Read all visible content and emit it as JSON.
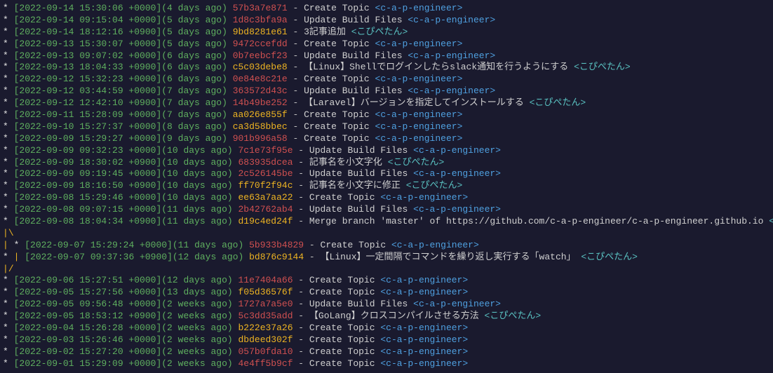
{
  "lines": [
    {
      "graph": "* ",
      "date": "[2022-09-14 15:30:06 +0000]",
      "ago": "(4 days ago)",
      "hash": "57b3a7e871",
      "hashColor": "red",
      "msg": "Create Topic",
      "author": "<c-a-p-engineer>",
      "authorClass": "author-cap"
    },
    {
      "graph": "* ",
      "date": "[2022-09-14 09:15:04 +0000]",
      "ago": "(5 days ago)",
      "hash": "1d8c3bfa9a",
      "hashColor": "red",
      "msg": "Update Build Files",
      "author": "<c-a-p-engineer>",
      "authorClass": "author-cap"
    },
    {
      "graph": "* ",
      "date": "[2022-09-14 18:12:16 +0900]",
      "ago": "(5 days ago)",
      "hash": "9bd8281e61",
      "hashColor": "",
      "msg": "3記事追加",
      "author": "<こぴぺたん>",
      "authorClass": "author-kt"
    },
    {
      "graph": "* ",
      "date": "[2022-09-13 15:30:07 +0000]",
      "ago": "(5 days ago)",
      "hash": "9472ccefdd",
      "hashColor": "red",
      "msg": "Create Topic",
      "author": "<c-a-p-engineer>",
      "authorClass": "author-cap"
    },
    {
      "graph": "* ",
      "date": "[2022-09-13 09:07:02 +0000]",
      "ago": "(6 days ago)",
      "hash": "0b7eebcf23",
      "hashColor": "red",
      "msg": "Update Build Files",
      "author": "<c-a-p-engineer>",
      "authorClass": "author-cap"
    },
    {
      "graph": "* ",
      "date": "[2022-09-13 18:04:33 +0900]",
      "ago": "(6 days ago)",
      "hash": "c5c03debe8",
      "hashColor": "",
      "msg": "【Linux】Shellでログインしたらslack通知を行うようにする",
      "author": "<こぴぺたん>",
      "authorClass": "author-kt"
    },
    {
      "graph": "* ",
      "date": "[2022-09-12 15:32:23 +0000]",
      "ago": "(6 days ago)",
      "hash": "0e84e8c21e",
      "hashColor": "red",
      "msg": "Create Topic",
      "author": "<c-a-p-engineer>",
      "authorClass": "author-cap"
    },
    {
      "graph": "* ",
      "date": "[2022-09-12 03:44:59 +0000]",
      "ago": "(7 days ago)",
      "hash": "363572d43c",
      "hashColor": "red",
      "msg": "Update Build Files",
      "author": "<c-a-p-engineer>",
      "authorClass": "author-cap"
    },
    {
      "graph": "* ",
      "date": "[2022-09-12 12:42:10 +0900]",
      "ago": "(7 days ago)",
      "hash": "14b49be252",
      "hashColor": "red",
      "msg": "【Laravel】バージョンを指定してインストールする",
      "author": "<こぴぺたん>",
      "authorClass": "author-kt"
    },
    {
      "graph": "* ",
      "date": "[2022-09-11 15:28:09 +0000]",
      "ago": "(7 days ago)",
      "hash": "aa026e855f",
      "hashColor": "",
      "msg": "Create Topic",
      "author": "<c-a-p-engineer>",
      "authorClass": "author-cap"
    },
    {
      "graph": "* ",
      "date": "[2022-09-10 15:27:37 +0000]",
      "ago": "(8 days ago)",
      "hash": "ca3d58bbec",
      "hashColor": "",
      "msg": "Create Topic",
      "author": "<c-a-p-engineer>",
      "authorClass": "author-cap"
    },
    {
      "graph": "* ",
      "date": "[2022-09-09 15:29:27 +0000]",
      "ago": "(9 days ago)",
      "hash": "901b996a58",
      "hashColor": "red",
      "msg": "Create Topic",
      "author": "<c-a-p-engineer>",
      "authorClass": "author-cap"
    },
    {
      "graph": "*   ",
      "date": "[2022-09-09 09:32:23 +0000]",
      "ago": "(10 days ago)",
      "hash": "7c1e73f95e",
      "hashColor": "red",
      "msg": "Update Build Files",
      "author": "<c-a-p-engineer>",
      "authorClass": "author-cap"
    },
    {
      "graph": "*   ",
      "date": "[2022-09-09 18:30:02 +0900]",
      "ago": "(10 days ago)",
      "hash": "683935dcea",
      "hashColor": "red",
      "msg": "記事名を小文字化",
      "author": "<こぴぺたん>",
      "authorClass": "author-kt"
    },
    {
      "graph": "*   ",
      "date": "[2022-09-09 09:19:45 +0000]",
      "ago": "(10 days ago)",
      "hash": "2c526145be",
      "hashColor": "red",
      "msg": "Update Build Files",
      "author": "<c-a-p-engineer>",
      "authorClass": "author-cap"
    },
    {
      "graph": "*   ",
      "date": "[2022-09-09 18:16:50 +0900]",
      "ago": "(10 days ago)",
      "hash": "ff70f2f94c",
      "hashColor": "",
      "msg": "記事名を小文字に修正",
      "author": "<こぴぺたん>",
      "authorClass": "author-kt"
    },
    {
      "graph": "*   ",
      "date": "[2022-09-08 15:29:46 +0000]",
      "ago": "(10 days ago)",
      "hash": "ee63a7aa22",
      "hashColor": "",
      "msg": "Create Topic",
      "author": "<c-a-p-engineer>",
      "authorClass": "author-cap"
    },
    {
      "graph": "*   ",
      "date": "[2022-09-08 09:07:15 +0000]",
      "ago": "(11 days ago)",
      "hash": "2b42762ab4",
      "hashColor": "red",
      "msg": "Update Build Files",
      "author": "<c-a-p-engineer>",
      "authorClass": "author-cap"
    },
    {
      "graph": "*   ",
      "date": "[2022-09-08 18:04:34 +0900]",
      "ago": "(11 days ago)",
      "hash": "d19c4ed24f",
      "hashColor": "",
      "msg": "Merge branch 'master' of https://github.com/c-a-p-engineer/c-a-p-engineer.github.io",
      "author": "<こぴぺたん>",
      "authorClass": "author-kt",
      "isMerge": true
    },
    {
      "graph": "|\\",
      "branchLine": true
    },
    {
      "graph": "| * ",
      "date": "[2022-09-07 15:29:24 +0000]",
      "ago": "(11 days ago)",
      "hash": "5b933b4829",
      "hashColor": "red",
      "msg": "Create Topic",
      "author": "<c-a-p-engineer>",
      "authorClass": "author-cap"
    },
    {
      "graph": "* | ",
      "date": "[2022-09-07 09:37:36 +0900]",
      "ago": "(12 days ago)",
      "hash": "bd876c9144",
      "hashColor": "",
      "msg": "【Linux】一定間隔でコマンドを繰り返し実行する「watch」",
      "author": "<こぴぺたん>",
      "authorClass": "author-kt"
    },
    {
      "graph": "|/",
      "branchLine": true
    },
    {
      "graph": "* ",
      "date": "[2022-09-06 15:27:51 +0000]",
      "ago": "(12 days ago)",
      "hash": "11e7404a66",
      "hashColor": "red",
      "msg": "Create Topic",
      "author": "<c-a-p-engineer>",
      "authorClass": "author-cap"
    },
    {
      "graph": "* ",
      "date": "[2022-09-05 15:27:56 +0000]",
      "ago": "(13 days ago)",
      "hash": "f05d36576f",
      "hashColor": "",
      "msg": "Create Topic",
      "author": "<c-a-p-engineer>",
      "authorClass": "author-cap"
    },
    {
      "graph": "* ",
      "date": "[2022-09-05 09:56:48 +0000]",
      "ago": "(2 weeks ago)",
      "hash": "1727a7a5e0",
      "hashColor": "red",
      "msg": "Update Build Files",
      "author": "<c-a-p-engineer>",
      "authorClass": "author-cap"
    },
    {
      "graph": "* ",
      "date": "[2022-09-05 18:53:12 +0900]",
      "ago": "(2 weeks ago)",
      "hash": "5c3dd35add",
      "hashColor": "red",
      "msg": "【GoLang】クロスコンパイルさせる方法",
      "author": "<こぴぺたん>",
      "authorClass": "author-kt"
    },
    {
      "graph": "* ",
      "date": "[2022-09-04 15:26:28 +0000]",
      "ago": "(2 weeks ago)",
      "hash": "b222e37a26",
      "hashColor": "",
      "msg": "Create Topic",
      "author": "<c-a-p-engineer>",
      "authorClass": "author-cap"
    },
    {
      "graph": "* ",
      "date": "[2022-09-03 15:26:46 +0000]",
      "ago": "(2 weeks ago)",
      "hash": "dbdeed302f",
      "hashColor": "",
      "msg": "Create Topic",
      "author": "<c-a-p-engineer>",
      "authorClass": "author-cap"
    },
    {
      "graph": "* ",
      "date": "[2022-09-02 15:27:20 +0000]",
      "ago": "(2 weeks ago)",
      "hash": "057b0fda10",
      "hashColor": "red",
      "msg": "Create Topic",
      "author": "<c-a-p-engineer>",
      "authorClass": "author-cap"
    },
    {
      "graph": "* ",
      "date": "[2022-09-01 15:29:09 +0000]",
      "ago": "(2 weeks ago)",
      "hash": "4e4ff5b9cf",
      "hashColor": "red",
      "msg": "Create Topic",
      "author": "<c-a-p-engineer>",
      "authorClass": "author-cap"
    }
  ]
}
